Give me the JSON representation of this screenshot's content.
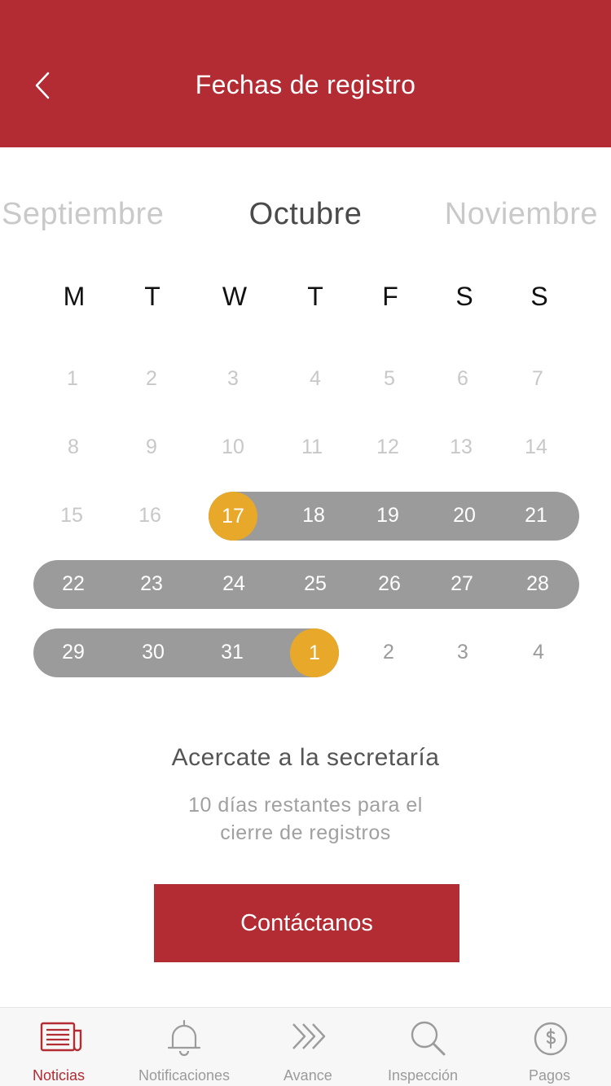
{
  "header": {
    "title": "Fechas de registro"
  },
  "months": {
    "prev": "Septiembre",
    "current": "Octubre",
    "next": "Noviembre"
  },
  "weekdays": [
    "M",
    "T",
    "W",
    "T",
    "F",
    "S",
    "S"
  ],
  "calendar": {
    "weeks": [
      [
        "1",
        "2",
        "3",
        "4",
        "5",
        "6",
        "7"
      ],
      [
        "8",
        "9",
        "10",
        "11",
        "12",
        "13",
        "14"
      ],
      [
        "15",
        "16",
        "17",
        "18",
        "19",
        "20",
        "21"
      ],
      [
        "22",
        "23",
        "24",
        "25",
        "26",
        "27",
        "28"
      ],
      [
        "29",
        "30",
        "31",
        "1",
        "2",
        "3",
        "4"
      ]
    ],
    "range_start": "17",
    "range_end": "1"
  },
  "info": {
    "title": "Acercate a la secretaría",
    "subtitle_line1": "10 días restantes para el",
    "subtitle_line2": "cierre de registros"
  },
  "contact_button": "Contáctanos",
  "tabs": [
    {
      "label": "Noticias",
      "icon": "newspaper-icon",
      "active": true
    },
    {
      "label": "Notificaciones",
      "icon": "bell-icon",
      "active": false
    },
    {
      "label": "Avance",
      "icon": "chevrons-right-icon",
      "active": false
    },
    {
      "label": "Inspección",
      "icon": "magnifier-icon",
      "active": false
    },
    {
      "label": "Pagos",
      "icon": "dollar-circle-icon",
      "active": false
    }
  ],
  "colors": {
    "brand_red": "#b32b33",
    "range_gray": "#9b9b9b",
    "highlight_gold": "#e8a92a"
  }
}
